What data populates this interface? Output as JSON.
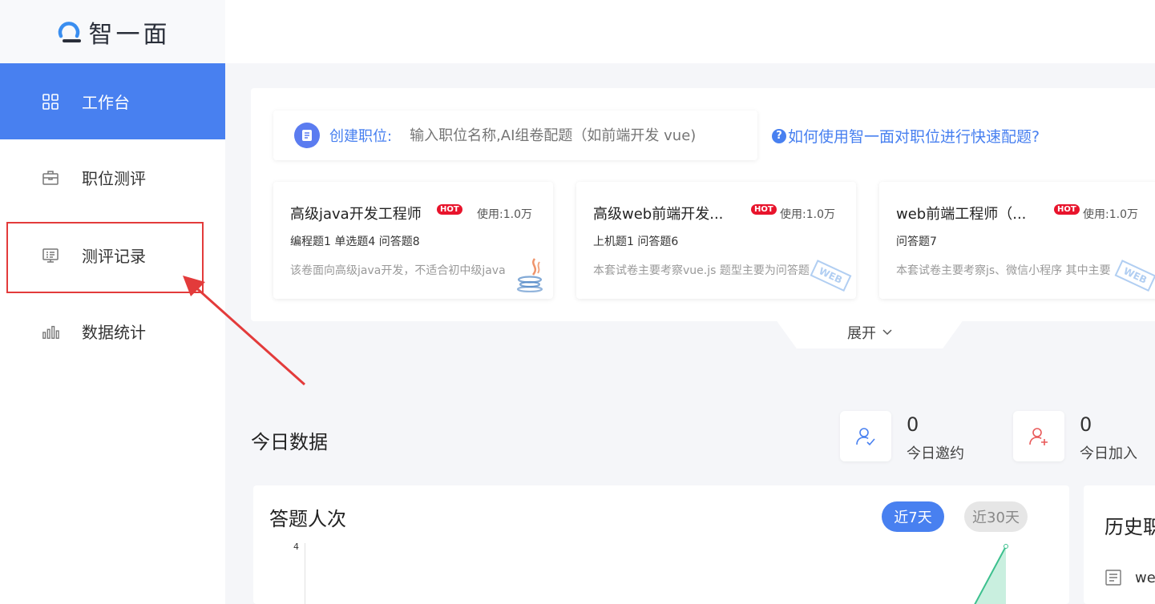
{
  "app": {
    "logo_text": "智一面"
  },
  "sidebar": {
    "items": [
      {
        "label": "工作台",
        "icon": "grid-icon",
        "active": true
      },
      {
        "label": "职位测评",
        "icon": "briefcase-icon",
        "active": false
      },
      {
        "label": "测评记录",
        "icon": "monitor-list-icon",
        "active": false
      },
      {
        "label": "数据统计",
        "icon": "bar-chart-icon",
        "active": false
      }
    ]
  },
  "create": {
    "label": "创建职位:",
    "placeholder": "输入职位名称,AI组卷配题（如前端开发 vue)",
    "help_link": "如何使用智一面对职位进行快速配题?",
    "help_icon": "?"
  },
  "cards": [
    {
      "title": "高级java开发工程师",
      "hot": "HOT",
      "usage": "使用:1.0万",
      "stats": "编程题1 单选题4 问答题8",
      "desc": "该卷面向高级java开发，不适合初中级java",
      "deco_icon": "java-icon"
    },
    {
      "title": "高级web前端开发...",
      "hot": "HOT",
      "usage": "使用:1.0万",
      "stats": "上机题1 问答题6",
      "desc": "本套试卷主要考察vue.js 题型主要为问答题",
      "deco_icon": "web-stamp-icon",
      "deco_text": "WEB"
    },
    {
      "title": "web前端工程师（...",
      "hot": "HOT",
      "usage": "使用:1.0万",
      "stats": "问答题7",
      "desc": "本套试卷主要考察js、微信小程序 其中主要",
      "deco_icon": "web-stamp-icon",
      "deco_text": "WEB"
    }
  ],
  "expand": {
    "label": "展开"
  },
  "today": {
    "title": "今日数据",
    "invite": {
      "value": "0",
      "label": "今日邀约"
    },
    "join": {
      "value": "0",
      "label": "今日加入"
    }
  },
  "chart": {
    "title": "答题人次",
    "tabs": [
      "近7天",
      "近30天"
    ],
    "active_tab": "近7天",
    "y_tick": "4"
  },
  "chart_data": {
    "type": "area",
    "title": "答题人次",
    "ylim": [
      0,
      4
    ],
    "y_ticks": [
      "4"
    ],
    "series": [
      {
        "values": [
          4
        ]
      }
    ]
  },
  "history": {
    "title": "历史职",
    "item": "we"
  },
  "colors": {
    "accent": "#4880f0",
    "hot": "#e8142c",
    "annotation": "#e33b3b",
    "chart_line": "#3cc08e"
  }
}
